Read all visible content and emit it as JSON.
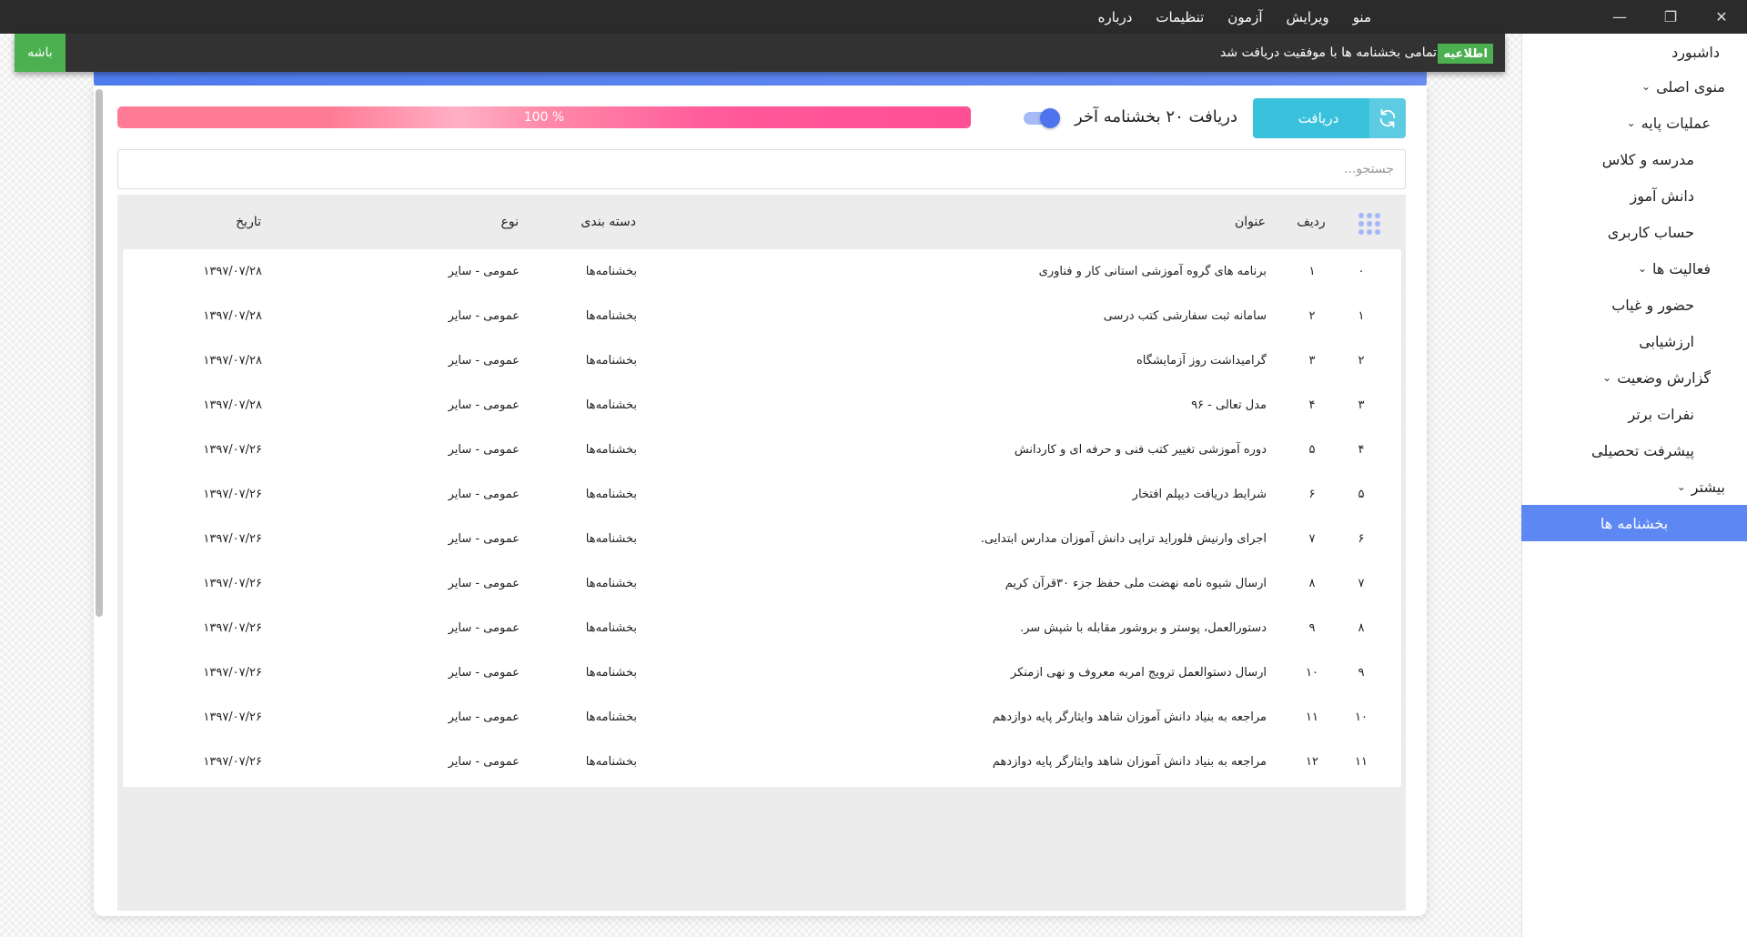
{
  "window": {
    "menu": [
      "منو",
      "ویرایش",
      "آزمون",
      "تنظیمات",
      "درباره"
    ]
  },
  "sidebar": {
    "items": [
      {
        "label": "داشبورد",
        "chevron": false
      },
      {
        "label": "منوی اصلی",
        "chevron": true
      },
      {
        "label": "عملیات پایه",
        "chevron": true
      },
      {
        "label": "مدرسه و کلاس",
        "chevron": false
      },
      {
        "label": "دانش آموز",
        "chevron": false
      },
      {
        "label": "حساب کاربری",
        "chevron": false
      },
      {
        "label": "فعالیت ها",
        "chevron": true
      },
      {
        "label": "حضور و غیاب",
        "chevron": false
      },
      {
        "label": "ارزشیابی",
        "chevron": false
      },
      {
        "label": "گزارش وضعیت",
        "chevron": true
      },
      {
        "label": "نفرات برتر",
        "chevron": false
      },
      {
        "label": "پیشرفت تحصیلی",
        "chevron": false
      },
      {
        "label": "بیشتر",
        "chevron": true
      },
      {
        "label": "بخشنامه ها",
        "chevron": false,
        "active": true
      }
    ]
  },
  "toast": {
    "badge": "اطلاعیه",
    "message": "تمامی بخشنامه ها با موفقیت دریافت شد",
    "action": "باشه"
  },
  "toolbar": {
    "fetch_button": "دریافت",
    "fetch_label": "دریافت ۲۰ بخشنامه آخر",
    "toggle_on": true,
    "progress_text": "100 %",
    "progress_value": 1.0,
    "search_placeholder": "جستجو..."
  },
  "table": {
    "headers": {
      "row": "ردیف",
      "title": "عنوان",
      "category": "دسته بندی",
      "type": "نوع",
      "date": "تاریخ"
    },
    "rows": [
      {
        "idx": "۰",
        "row": "۱",
        "title": "برنامه های گروه آموزشی استانی کار و فناوری",
        "category": "بخشنامه‌ها",
        "type": "عمومی - سایر",
        "date": "۱۳۹۷/۰۷/۲۸"
      },
      {
        "idx": "۱",
        "row": "۲",
        "title": "سامانه ثبت سفارشی کتب درسی",
        "category": "بخشنامه‌ها",
        "type": "عمومی - سایر",
        "date": "۱۳۹۷/۰۷/۲۸"
      },
      {
        "idx": "۲",
        "row": "۳",
        "title": "گرامیداشت روز آزمایشگاه",
        "category": "بخشنامه‌ها",
        "type": "عمومی - سایر",
        "date": "۱۳۹۷/۰۷/۲۸"
      },
      {
        "idx": "۳",
        "row": "۴",
        "title": "مدل تعالی - ۹۶",
        "category": "بخشنامه‌ها",
        "type": "عمومی - سایر",
        "date": "۱۳۹۷/۰۷/۲۸"
      },
      {
        "idx": "۴",
        "row": "۵",
        "title": "دوره آموزشی تغییر کتب فنی و حرفه ای و کاردانش",
        "category": "بخشنامه‌ها",
        "type": "عمومی - سایر",
        "date": "۱۳۹۷/۰۷/۲۶"
      },
      {
        "idx": "۵",
        "row": "۶",
        "title": "شرایط دریافت دیپلم افتخار",
        "category": "بخشنامه‌ها",
        "type": "عمومی - سایر",
        "date": "۱۳۹۷/۰۷/۲۶"
      },
      {
        "idx": "۶",
        "row": "۷",
        "title": "اجرای وارنیش فلوراید تراپی دانش آموزان مدارس ابتدایی.",
        "category": "بخشنامه‌ها",
        "type": "عمومی - سایر",
        "date": "۱۳۹۷/۰۷/۲۶"
      },
      {
        "idx": "۷",
        "row": "۸",
        "title": "ارسال شیوه نامه نهضت ملی حفظ جزء ۳۰قرآن کریم",
        "category": "بخشنامه‌ها",
        "type": "عمومی - سایر",
        "date": "۱۳۹۷/۰۷/۲۶"
      },
      {
        "idx": "۸",
        "row": "۹",
        "title": "دستورالعمل، پوستر و بروشور مقابله با شپش سر.",
        "category": "بخشنامه‌ها",
        "type": "عمومی - سایر",
        "date": "۱۳۹۷/۰۷/۲۶"
      },
      {
        "idx": "۹",
        "row": "۱۰",
        "title": "ارسال دستوالعمل ترویج امربه معروف و نهی ازمنکر",
        "category": "بخشنامه‌ها",
        "type": "عمومی - سایر",
        "date": "۱۳۹۷/۰۷/۲۶"
      },
      {
        "idx": "۱۰",
        "row": "۱۱",
        "title": "مراجعه به بنیاد دانش آموزان شاهد وایثارگر  پایه دوازدهم",
        "category": "بخشنامه‌ها",
        "type": "عمومی - سایر",
        "date": "۱۳۹۷/۰۷/۲۶"
      },
      {
        "idx": "۱۱",
        "row": "۱۲",
        "title": "مراجعه به بنیاد دانش آموزان شاهد وایثارگر  پایه دوازدهم",
        "category": "بخشنامه‌ها",
        "type": "عمومی - سایر",
        "date": "۱۳۹۷/۰۷/۲۶"
      }
    ]
  },
  "colors": {
    "accent": "#5d87f3",
    "fetch_button": "#3ac1dc",
    "toast_action": "#4caf50",
    "progress_end": "#ff4f95"
  }
}
